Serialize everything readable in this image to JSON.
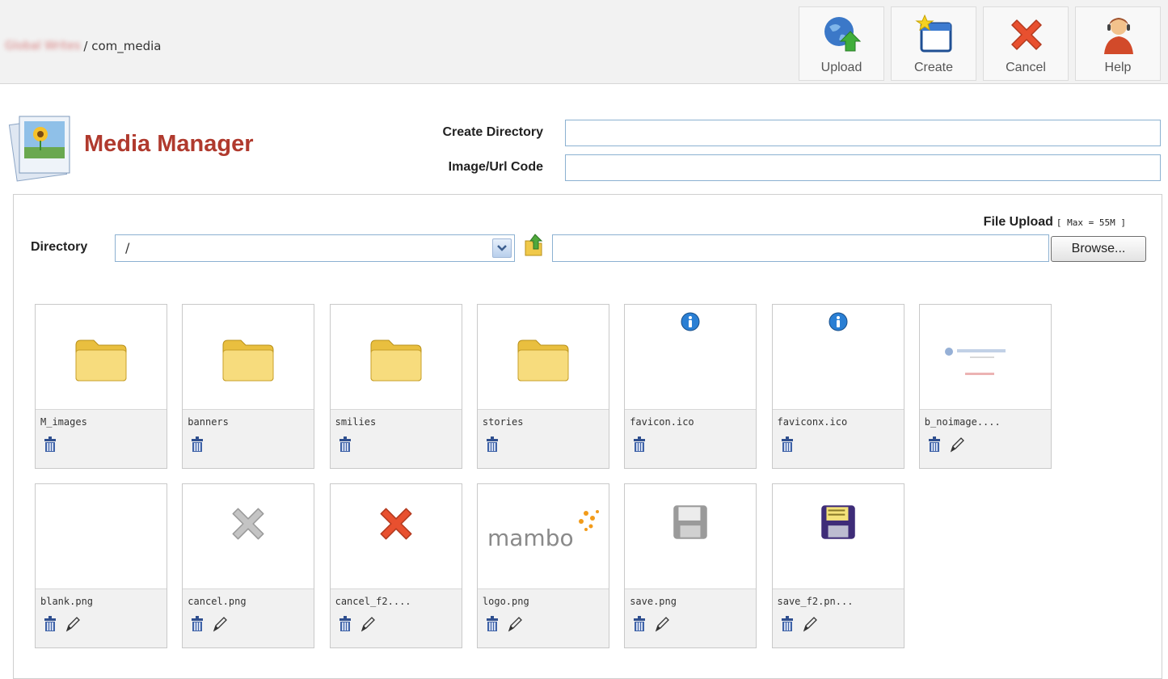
{
  "header": {
    "site_name": "Global Writes",
    "breadcrumb_path": "/ com_media"
  },
  "toolbar": {
    "upload_label": "Upload",
    "create_label": "Create",
    "cancel_label": "Cancel",
    "help_label": "Help"
  },
  "page": {
    "title": "Media Manager",
    "create_directory_label": "Create Directory",
    "create_directory_value": "",
    "image_url_code_label": "Image/Url Code",
    "image_url_code_value": ""
  },
  "upload": {
    "file_upload_label": "File Upload",
    "max_label": "[ Max = 55M ]",
    "directory_label": "Directory",
    "directory_value": "/",
    "browse_label": "Browse..."
  },
  "files": [
    {
      "name": "M_images",
      "kind": "folder"
    },
    {
      "name": "banners",
      "kind": "folder"
    },
    {
      "name": "smilies",
      "kind": "folder"
    },
    {
      "name": "stories",
      "kind": "folder"
    },
    {
      "name": "favicon.ico",
      "kind": "info"
    },
    {
      "name": "faviconx.ico",
      "kind": "info"
    },
    {
      "name": "b_noimage....",
      "kind": "noimage"
    },
    {
      "name": "blank.png",
      "kind": "blank"
    },
    {
      "name": "cancel.png",
      "kind": "cancel-gray"
    },
    {
      "name": "cancel_f2....",
      "kind": "cancel-red"
    },
    {
      "name": "logo.png",
      "kind": "logo"
    },
    {
      "name": "save.png",
      "kind": "save-gray"
    },
    {
      "name": "save_f2.pn...",
      "kind": "save-color"
    }
  ],
  "logo_text": "mambo",
  "colors": {
    "title_red": "#b03a2e",
    "input_border": "#8cb1d1",
    "folder_yellow": "#f3d56a",
    "cancel_red": "#e8502f",
    "info_blue": "#2a7fd4"
  }
}
